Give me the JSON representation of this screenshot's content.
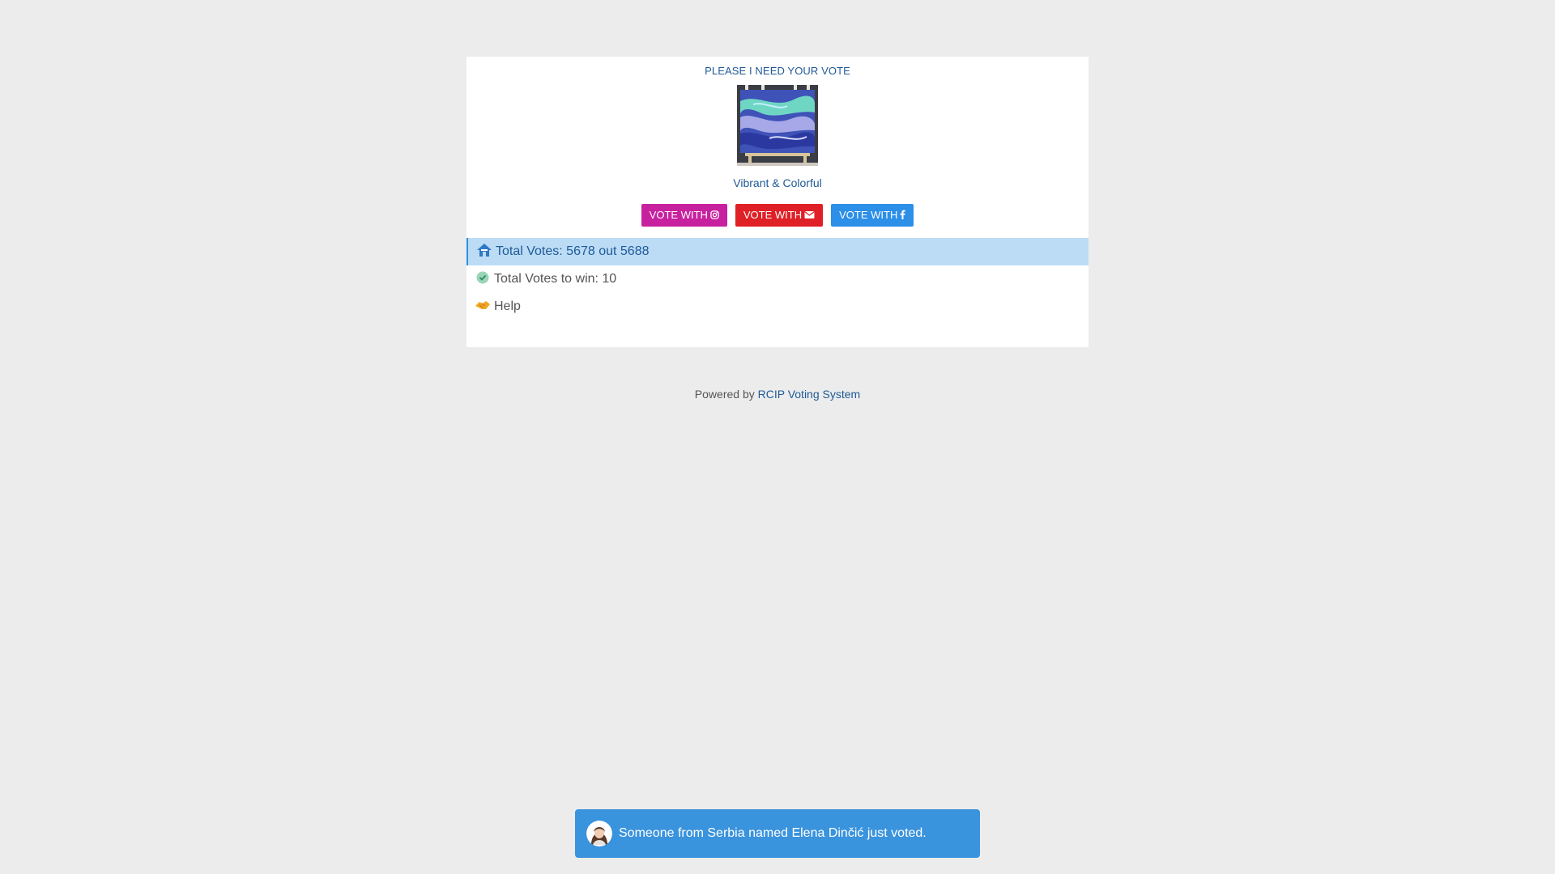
{
  "card": {
    "title": "PLEASE I NEED YOUR VOTE",
    "image_alt": "painting",
    "subtitle": "Vibrant & Colorful",
    "buttons": [
      {
        "label": "VOTE WITH",
        "icon": "instagram-icon",
        "color": "#c8219f"
      },
      {
        "label": "VOTE WITH",
        "icon": "envelope-icon",
        "color": "#df2026"
      },
      {
        "label": "VOTE WITH",
        "icon": "facebook-icon",
        "color": "#2c8fe8"
      }
    ],
    "list": [
      {
        "label": "Total Votes: 5678 out 5688",
        "icon": "house-icon",
        "active": true
      },
      {
        "label": "Total Votes to win: 10",
        "icon": "check-circle-icon",
        "active": false
      },
      {
        "label": "Help",
        "icon": "handshake-icon",
        "active": false
      }
    ]
  },
  "footer": {
    "prefix": "Powered by ",
    "link_label": "RCIP Voting System"
  },
  "toast": {
    "message": "Someone from Serbia named Elena Dinčić just voted.",
    "avatar_icon": "avatar-icon"
  },
  "colors": {
    "background": "#ececec",
    "link": "#1f5a96",
    "active_row": "#bcdcf6",
    "toast": "#3a93dd"
  }
}
